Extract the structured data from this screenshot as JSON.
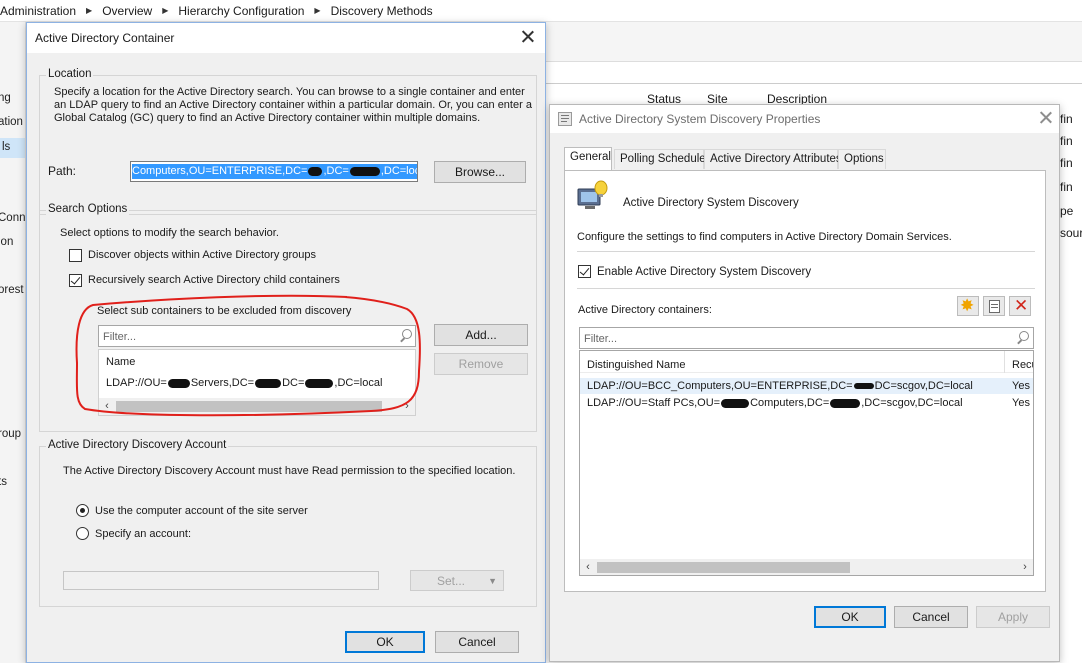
{
  "breadcrumb": [
    "Administration",
    "Overview",
    "Hierarchy Configuration",
    "Discovery Methods"
  ],
  "left_nav": [
    "ng",
    "ation",
    "ls",
    "Conne",
    "ion",
    "orest",
    "roup",
    "ts"
  ],
  "bg_table": {
    "columns": [
      "Status",
      "Site",
      "Description"
    ],
    "right_fragments": [
      "fin",
      "fin",
      "fin",
      "fin",
      "pe",
      "sour"
    ]
  },
  "container_dialog": {
    "title": "Active Directory Container",
    "location": {
      "legend": "Location",
      "desc": "Specify a location for the Active Directory search. You can browse to a single container and enter an LDAP query to find an Active Directory container within a particular domain. Or, you can enter a Global Catalog (GC) query to find an Active Directory container within multiple domains.",
      "path_label": "Path:",
      "path_pre": "Computers,OU=ENTERPRISE,DC=",
      "path_mid": ",DC=",
      "path_post": ",DC=local",
      "browse": "Browse..."
    },
    "search_options": {
      "legend": "Search Options",
      "desc": "Select options to modify the search behavior.",
      "opt1": "Discover objects within Active Directory groups",
      "opt2": "Recursively search Active Directory child containers",
      "exclude_label": "Select sub containers to be excluded from discovery",
      "filter_placeholder": "Filter...",
      "col_name": "Name",
      "row_pre": "LDAP://OU=",
      "row_mid1": "Servers,DC=",
      "row_mid2": "DC=",
      "row_post": ",DC=local",
      "add": "Add...",
      "remove": "Remove"
    },
    "account": {
      "legend": "Active Directory Discovery Account",
      "desc": "The Active Directory Discovery Account must have Read permission to the specified location.",
      "opt_computer": "Use the computer account of the site server",
      "opt_specify": "Specify an account:",
      "set": "Set..."
    },
    "ok": "OK",
    "cancel": "Cancel"
  },
  "props_dialog": {
    "title": "Active Directory System Discovery Properties",
    "tabs": [
      "General",
      "Polling Schedule",
      "Active Directory Attributes",
      "Options"
    ],
    "heading": "Active Directory System Discovery",
    "desc": "Configure the settings to find computers in Active Directory Domain Services.",
    "enable": "Enable Active Directory System Discovery",
    "containers_label": "Active Directory containers:",
    "filter_placeholder": "Filter...",
    "col_dn": "Distinguished Name",
    "col_rec": "Recu",
    "rows": [
      {
        "pre": "LDAP://OU=BCC_Computers,OU=ENTERPRISE,DC=",
        "mid": "DC=scgov,DC=local",
        "rec": "Yes"
      },
      {
        "pre": "LDAP://OU=Staff PCs,OU=",
        "mid1": "Computers,DC=",
        "mid2": ",DC=scgov,DC=local",
        "rec": "Yes"
      }
    ],
    "ok": "OK",
    "cancel": "Cancel",
    "apply": "Apply"
  },
  "colors": {
    "accent": "#0078d7",
    "selection": "#3399ff",
    "annotation": "#e0201b"
  }
}
